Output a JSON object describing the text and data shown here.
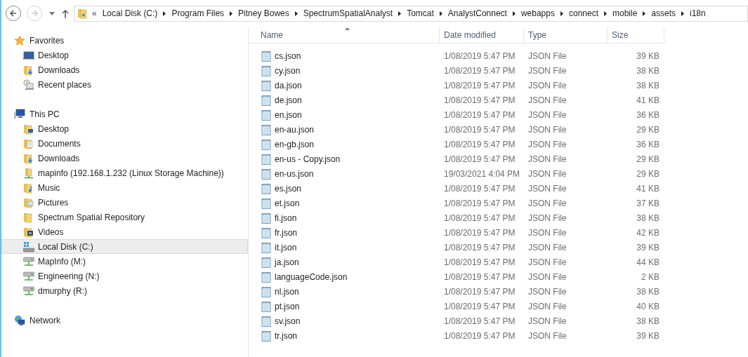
{
  "toolbar": {
    "back_enabled": true,
    "forward_enabled": false
  },
  "address_bar": {
    "overflow": "«",
    "segments": [
      "Local Disk (C:)",
      "Program Files",
      "Pitney Bowes",
      "SpectrumSpatialAnalyst",
      "Tomcat",
      "AnalystConnect",
      "webapps",
      "connect",
      "mobile",
      "assets",
      "i18n"
    ]
  },
  "sidebar": {
    "sections": [
      {
        "label": "Favorites",
        "kind": "star",
        "items": [
          {
            "label": "Desktop",
            "kind": "desktop",
            "selected": false
          },
          {
            "label": "Downloads",
            "kind": "downloads",
            "selected": false
          },
          {
            "label": "Recent places",
            "kind": "recent",
            "selected": false
          }
        ]
      },
      {
        "label": "This PC",
        "kind": "pc",
        "items": [
          {
            "label": "Desktop",
            "kind": "folder-desktop",
            "selected": false
          },
          {
            "label": "Documents",
            "kind": "documents",
            "selected": false
          },
          {
            "label": "Downloads",
            "kind": "downloads",
            "selected": false
          },
          {
            "label": "mapinfo (192.168.1.232 (Linux Storage Machine))",
            "kind": "share",
            "selected": false
          },
          {
            "label": "Music",
            "kind": "music",
            "selected": false
          },
          {
            "label": "Pictures",
            "kind": "pictures",
            "selected": false
          },
          {
            "label": "Spectrum Spatial Repository",
            "kind": "folder",
            "selected": false
          },
          {
            "label": "Videos",
            "kind": "videos",
            "selected": false
          },
          {
            "label": "Local Disk (C:)",
            "kind": "disk",
            "selected": true
          },
          {
            "label": "MapInfo (M:)",
            "kind": "netdrive",
            "selected": false
          },
          {
            "label": "Engineering (N:)",
            "kind": "netdrive",
            "selected": false
          },
          {
            "label": "dmurphy (R:)",
            "kind": "netdrive",
            "selected": false
          }
        ]
      },
      {
        "label": "Network",
        "kind": "network"
      }
    ]
  },
  "table": {
    "columns": [
      {
        "label": "Name",
        "sorted": true
      },
      {
        "label": "Date modified",
        "sorted": false
      },
      {
        "label": "Type",
        "sorted": false
      },
      {
        "label": "Size",
        "sorted": false
      }
    ],
    "rows": [
      [
        "cs.json",
        "1/08/2019 5:47 PM",
        "JSON File",
        "39 KB"
      ],
      [
        "cy.json",
        "1/08/2019 5:47 PM",
        "JSON File",
        "38 KB"
      ],
      [
        "da.json",
        "1/08/2019 5:47 PM",
        "JSON File",
        "38 KB"
      ],
      [
        "de.json",
        "1/08/2019 5:47 PM",
        "JSON File",
        "41 KB"
      ],
      [
        "en.json",
        "1/08/2019 5:47 PM",
        "JSON File",
        "36 KB"
      ],
      [
        "en-au.json",
        "1/08/2019 5:47 PM",
        "JSON File",
        "29 KB"
      ],
      [
        "en-gb.json",
        "1/08/2019 5:47 PM",
        "JSON File",
        "36 KB"
      ],
      [
        "en-us - Copy.json",
        "1/08/2019 5:47 PM",
        "JSON File",
        "29 KB"
      ],
      [
        "en-us.json",
        "19/03/2021 4:04 PM",
        "JSON File",
        "29 KB"
      ],
      [
        "es.json",
        "1/08/2019 5:47 PM",
        "JSON File",
        "41 KB"
      ],
      [
        "et.json",
        "1/08/2019 5:47 PM",
        "JSON File",
        "37 KB"
      ],
      [
        "fi.json",
        "1/08/2019 5:47 PM",
        "JSON File",
        "38 KB"
      ],
      [
        "fr.json",
        "1/08/2019 5:47 PM",
        "JSON File",
        "42 KB"
      ],
      [
        "it.json",
        "1/08/2019 5:47 PM",
        "JSON File",
        "39 KB"
      ],
      [
        "ja.json",
        "1/08/2019 5:47 PM",
        "JSON File",
        "44 KB"
      ],
      [
        "languageCode.json",
        "1/08/2019 5:47 PM",
        "JSON File",
        "2 KB"
      ],
      [
        "nl.json",
        "1/08/2019 5:47 PM",
        "JSON File",
        "38 KB"
      ],
      [
        "pt.json",
        "1/08/2019 5:47 PM",
        "JSON File",
        "40 KB"
      ],
      [
        "sv.json",
        "1/08/2019 5:47 PM",
        "JSON File",
        "38 KB"
      ],
      [
        "tr.json",
        "1/08/2019 5:47 PM",
        "JSON File",
        "39 KB"
      ]
    ]
  }
}
